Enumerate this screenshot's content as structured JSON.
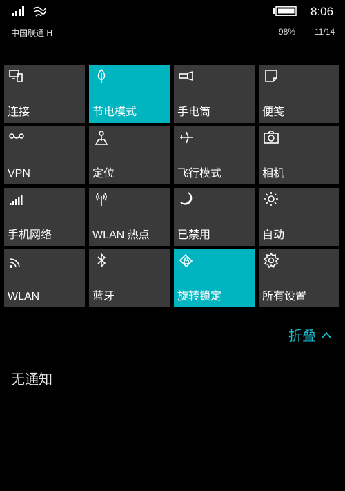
{
  "status": {
    "time": "8:06",
    "carrier": "中国联通 H",
    "battery_percent": "98%",
    "date": "11/14",
    "signal_icon": "signal-bars-icon",
    "wifi_icon": "wifi-icon",
    "battery_icon": "battery-icon"
  },
  "tiles": [
    {
      "label": "连接",
      "icon": "connect-icon",
      "active": false
    },
    {
      "label": "节电模式",
      "icon": "leaf-icon",
      "active": true
    },
    {
      "label": "手电筒",
      "icon": "flashlight-icon",
      "active": false
    },
    {
      "label": "便笺",
      "icon": "note-icon",
      "active": false
    },
    {
      "label": "VPN",
      "icon": "vpn-icon",
      "active": false
    },
    {
      "label": "定位",
      "icon": "location-icon",
      "active": false
    },
    {
      "label": "飞行模式",
      "icon": "airplane-icon",
      "active": false
    },
    {
      "label": "相机",
      "icon": "camera-icon",
      "active": false
    },
    {
      "label": "手机网络",
      "icon": "cellular-icon",
      "active": false
    },
    {
      "label": "WLAN 热点",
      "icon": "hotspot-icon",
      "active": false
    },
    {
      "label": "已禁用",
      "icon": "moon-icon",
      "active": false
    },
    {
      "label": "自动",
      "icon": "brightness-icon",
      "active": false
    },
    {
      "label": "WLAN",
      "icon": "wlan-icon",
      "active": false
    },
    {
      "label": "蓝牙",
      "icon": "bluetooth-icon",
      "active": false
    },
    {
      "label": "旋转锁定",
      "icon": "rotation-lock-icon",
      "active": true
    },
    {
      "label": "所有设置",
      "icon": "settings-icon",
      "active": false
    }
  ],
  "collapse": {
    "label": "折叠"
  },
  "notifications": {
    "empty_text": "无通知"
  },
  "colors": {
    "accent": "#00b4c0",
    "tile": "#3a3a3a",
    "background": "#000000"
  }
}
